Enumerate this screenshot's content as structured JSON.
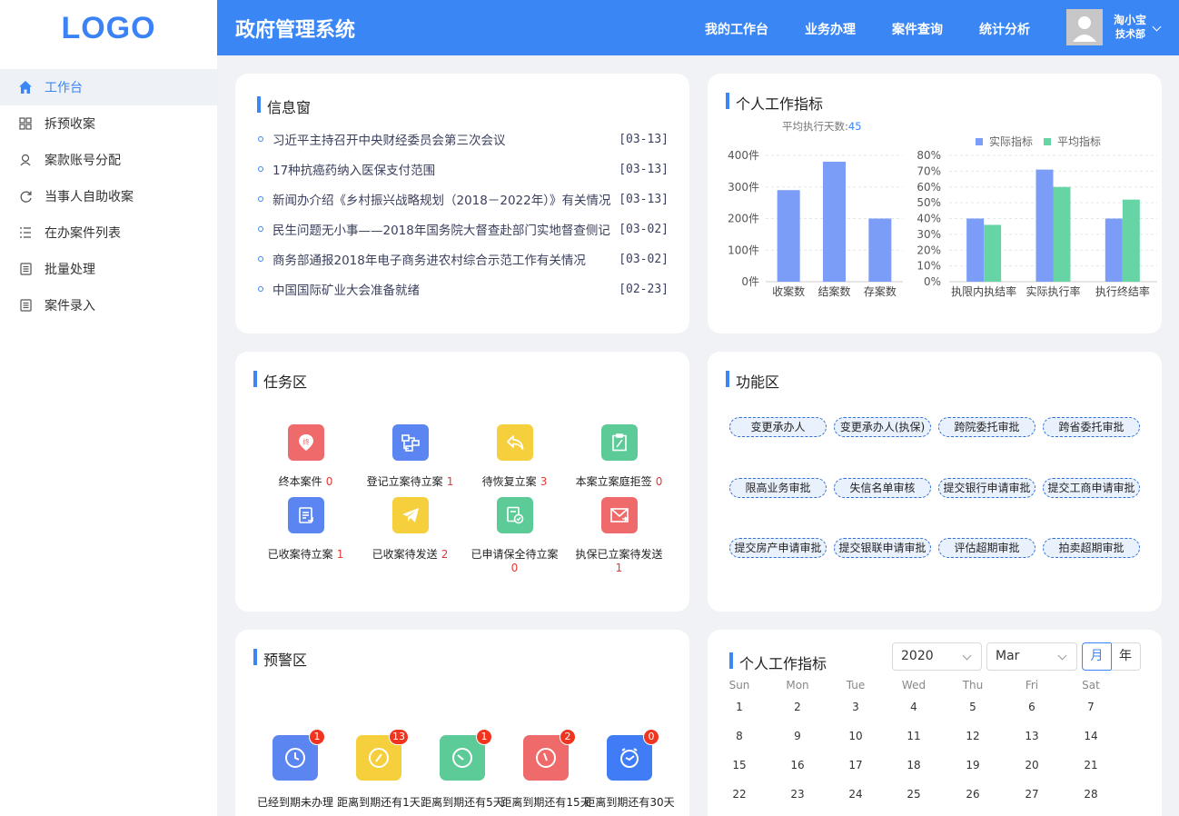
{
  "logo": "LOGO",
  "menu": [
    {
      "label": "工作台",
      "icon": "home-icon"
    },
    {
      "label": "拆预收案",
      "icon": "grid-icon"
    },
    {
      "label": "案款账号分配",
      "icon": "person-icon"
    },
    {
      "label": "当事人自助收案",
      "icon": "refresh-icon"
    },
    {
      "label": "在办案件列表",
      "icon": "list-icon"
    },
    {
      "label": "批量处理",
      "icon": "document-icon"
    },
    {
      "label": "案件录入",
      "icon": "document-icon"
    }
  ],
  "header": {
    "title": "政府管理系统",
    "nav": [
      "我的工作台",
      "业务办理",
      "案件查询",
      "统计分析"
    ],
    "user": {
      "name": "淘小宝",
      "dept": "技术部"
    },
    "color": "#3a86f5"
  },
  "info": {
    "title": "信息窗",
    "items": [
      {
        "text": "习近平主持召开中央财经委员会第三次会议",
        "date": "[03-13]"
      },
      {
        "text": "17种抗癌药纳入医保支付范围",
        "date": "[03-13]"
      },
      {
        "text": "新闻办介绍《乡村振兴战略规划（2018－2022年）》有关情况",
        "date": "[03-13]"
      },
      {
        "text": "民生问题无小事——2018年国务院大督查赴部门实地督查侧记",
        "date": "[03-02]"
      },
      {
        "text": "商务部通报2018年电子商务进农村综合示范工作有关情况",
        "date": "[03-02]"
      },
      {
        "text": "中国国际矿业大会准备就绪",
        "date": "[02-23]"
      }
    ]
  },
  "metrics": {
    "title": "个人工作指标",
    "avg_label": "平均执行天数:",
    "avg_value": "45"
  },
  "chart_data": [
    {
      "type": "bar",
      "categories": [
        "收案数",
        "结案数",
        "存案数"
      ],
      "values": [
        290,
        380,
        200
      ],
      "ylim": [
        0,
        400
      ],
      "yticks": [
        "0件",
        "100件",
        "200件",
        "300件",
        "400件"
      ],
      "color": "#7b9cf7"
    },
    {
      "type": "bar",
      "categories": [
        "执限内执结率",
        "实际执行率",
        "执行终结率"
      ],
      "series": [
        {
          "name": "实际指标",
          "values": [
            40,
            71,
            40
          ],
          "color": "#7b9cf7"
        },
        {
          "name": "平均指标",
          "values": [
            36,
            60,
            52
          ],
          "color": "#67d4a5"
        }
      ],
      "ylim": [
        0,
        80
      ],
      "yticks": [
        "0%",
        "10%",
        "20%",
        "30%",
        "40%",
        "50%",
        "60%",
        "70%",
        "80%"
      ],
      "legend": "top"
    }
  ],
  "tasks": {
    "title": "任务区",
    "items": [
      {
        "label": "终本案件",
        "count": "0",
        "color": "#ef6b6b",
        "icon": "pin-icon"
      },
      {
        "label": "登记立案待立案",
        "count": "1",
        "color": "#5b86f2",
        "icon": "flow-icon"
      },
      {
        "label": "待恢复立案",
        "count": "3",
        "color": "#f5cf3c",
        "icon": "reply-icon"
      },
      {
        "label": "本案立案庭拒签",
        "count": "0",
        "color": "#5ccb97",
        "icon": "clipboard-icon"
      },
      {
        "label": "已收案待立案",
        "count": "1",
        "color": "#5b86f2",
        "icon": "file-icon"
      },
      {
        "label": "已收案待发送",
        "count": "2",
        "color": "#f5cf3c",
        "icon": "send-icon"
      },
      {
        "label": "已申请保全待立案",
        "count": "0",
        "color": "#5ccb97",
        "icon": "check-doc-icon"
      },
      {
        "label": "执保已立案待发送",
        "count": "1",
        "color": "#ef6b6b",
        "icon": "mail-icon"
      }
    ]
  },
  "functions": {
    "title": "功能区",
    "items": [
      "变更承办人",
      "变更承办人(执保)",
      "跨院委托审批",
      "跨省委托审批",
      "限高业务审批",
      "失信名单审核",
      "提交银行申请审批",
      "提交工商申请审批",
      "提交房产申请审批",
      "提交银联申请审批",
      "评估超期审批",
      "拍卖超期审批"
    ]
  },
  "warnings": {
    "title": "预警区",
    "items": [
      {
        "label": "已经到期未办理",
        "count": "1",
        "color": "#5b86f2"
      },
      {
        "label": "距离到期还有1天",
        "count": "13",
        "color": "#f5cf3c"
      },
      {
        "label": "距离到期还有5天",
        "count": "1",
        "color": "#5ccb97"
      },
      {
        "label": "距离到期还有15天",
        "count": "2",
        "color": "#ef6b6b"
      },
      {
        "label": "距离到期还有30天",
        "count": "0",
        "color": "#3f7cf5"
      }
    ]
  },
  "calendar": {
    "title": "个人工作指标",
    "year": "2020",
    "month": "Mar",
    "mode_month": "月",
    "mode_year": "年",
    "weekdays": [
      "Sun",
      "Mon",
      "Tue",
      "Wed",
      "Thu",
      "Fri",
      "Sat"
    ],
    "weeks": [
      [
        "1",
        "2",
        "3",
        "4",
        "5",
        "6",
        "7"
      ],
      [
        "8",
        "9",
        "10",
        "11",
        "12",
        "13",
        "14"
      ],
      [
        "15",
        "16",
        "17",
        "18",
        "19",
        "20",
        "21"
      ],
      [
        "22",
        "23",
        "24",
        "25",
        "26",
        "27",
        "28"
      ]
    ]
  }
}
